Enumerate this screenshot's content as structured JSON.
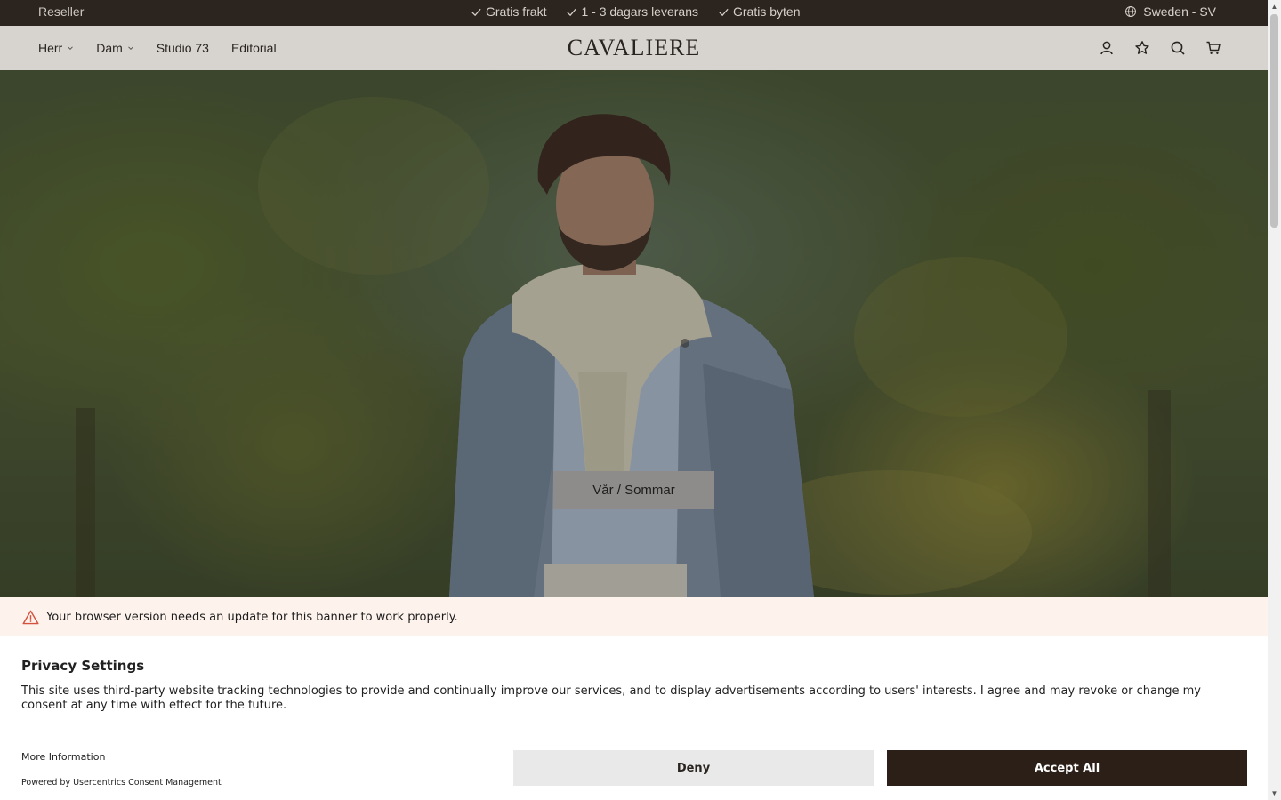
{
  "topbar": {
    "reseller": "Reseller",
    "usps": [
      "Gratis frakt",
      "1 - 3 dagars leverans",
      "Gratis byten"
    ],
    "locale": "Sweden - SV"
  },
  "header": {
    "nav": [
      {
        "label": "Herr",
        "has_dropdown": true
      },
      {
        "label": "Dam",
        "has_dropdown": true
      },
      {
        "label": "Studio 73",
        "has_dropdown": false
      },
      {
        "label": "Editorial",
        "has_dropdown": false
      }
    ],
    "logo": "CAVALIERE",
    "icons": [
      "account-icon",
      "wishlist-star-icon",
      "search-icon",
      "cart-icon"
    ]
  },
  "hero": {
    "cta_label": "Vår / Sommar"
  },
  "warning": {
    "text": "Your browser version needs an update for this banner to work properly."
  },
  "consent": {
    "title": "Privacy Settings",
    "description": "This site uses third-party website tracking technologies to provide and continually improve our services, and to display advertisements according to users' interests. I agree and may revoke or change my consent at any time with effect for the future.",
    "more_info": "More Information",
    "powered_by": "Powered by Usercentrics Consent Management",
    "deny_label": "Deny",
    "accept_label": "Accept All"
  },
  "colors": {
    "topbar_bg": "#2c241e",
    "header_bg": "#d7d4d0",
    "accept_bg": "#2c1f17",
    "deny_bg": "#e9e9e9",
    "warning_bg": "#fef2ec"
  }
}
